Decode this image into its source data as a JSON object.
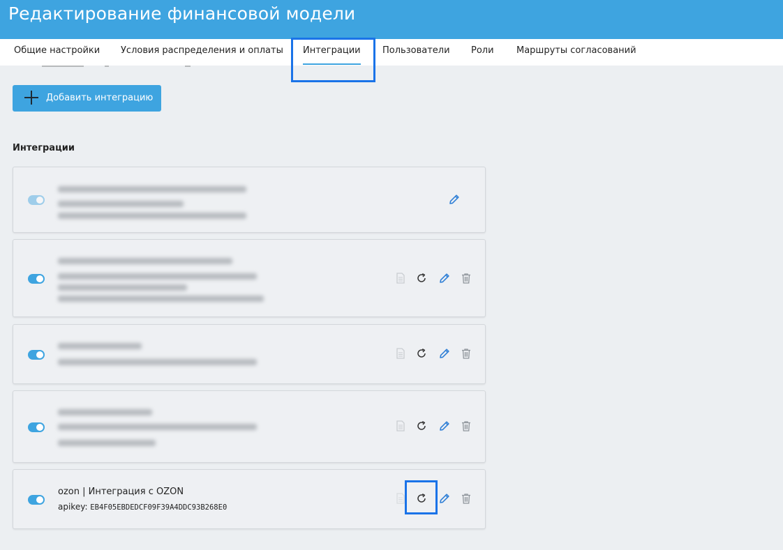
{
  "header": {
    "title": "Редактирование финансовой модели"
  },
  "tabs": [
    {
      "label": "Общие настройки"
    },
    {
      "label": "Условия распределения и оплаты"
    },
    {
      "label": "Интеграции"
    },
    {
      "label": "Пользователи"
    },
    {
      "label": "Роли"
    },
    {
      "label": "Маршруты согласований"
    }
  ],
  "active_tab": "Интеграции",
  "toolbar": {
    "add_label": "Добавить интеграцию",
    "add_icon": "plus-icon"
  },
  "section": {
    "title": "Интеграции"
  },
  "integrations": [
    {
      "enabled": true,
      "disabled_style": true,
      "actions": [
        "edit"
      ]
    },
    {
      "enabled": true,
      "actions": [
        "document",
        "reload",
        "edit",
        "delete"
      ]
    },
    {
      "enabled": true,
      "actions": [
        "document",
        "reload",
        "edit",
        "delete"
      ]
    },
    {
      "enabled": true,
      "actions": [
        "document",
        "reload",
        "edit",
        "delete"
      ]
    },
    {
      "enabled": true,
      "name": "ozon | Интеграция с OZON",
      "apikey_label": "apikey: ",
      "apikey_value": "EB4F05EBDEDCF09F39A4DDC93B268E0",
      "actions": [
        "document",
        "reload",
        "edit",
        "delete"
      ]
    }
  ],
  "colors": {
    "brand": "#3ea4e0",
    "highlight": "#1a73e8",
    "edit_icon": "#2f7fd6",
    "muted_icon": "#9aa0a6"
  }
}
